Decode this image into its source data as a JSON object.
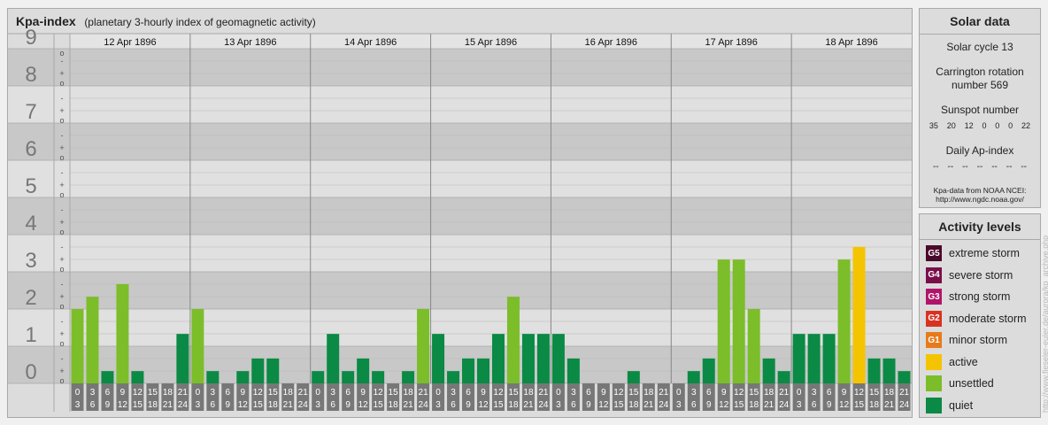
{
  "header": {
    "title": "Kpa-index",
    "subtitle": "(planetary 3-hourly index of geomagnetic activity)"
  },
  "chart_data": {
    "type": "bar",
    "title": "Kpa-index",
    "subtitle": "(planetary 3-hourly index of geomagnetic activity)",
    "ylim": [
      0,
      9
    ],
    "y_major_ticks": [
      "0",
      "1",
      "2",
      "3",
      "4",
      "5",
      "6",
      "7",
      "8",
      "9"
    ],
    "y_minor_ticks": [
      "o",
      "+",
      "-"
    ],
    "days": [
      "12 Apr 1896",
      "13 Apr 1896",
      "14 Apr 1896",
      "15 Apr 1896",
      "16 Apr 1896",
      "17 Apr 1896",
      "18 Apr 1896"
    ],
    "interval_labels": [
      [
        "0",
        "3"
      ],
      [
        "3",
        "6"
      ],
      [
        "6",
        "9"
      ],
      [
        "9",
        "12"
      ],
      [
        "12",
        "15"
      ],
      [
        "15",
        "18"
      ],
      [
        "18",
        "21"
      ],
      [
        "21",
        "24"
      ]
    ],
    "values": [
      2.0,
      2.33,
      0.33,
      2.67,
      0.33,
      0.0,
      0.0,
      1.33,
      2.0,
      0.33,
      0.0,
      0.33,
      0.67,
      0.67,
      0.0,
      0.0,
      0.33,
      1.33,
      0.33,
      0.67,
      0.33,
      0.0,
      0.33,
      2.0,
      1.33,
      0.33,
      0.67,
      0.67,
      1.33,
      2.33,
      1.33,
      1.33,
      1.33,
      0.67,
      0.0,
      0.0,
      0.0,
      0.33,
      0.0,
      0.0,
      0.0,
      0.33,
      0.67,
      3.33,
      3.33,
      2.0,
      0.67,
      0.33,
      1.33,
      1.33,
      1.33,
      3.33,
      3.67,
      0.67,
      0.67,
      0.33
    ],
    "colors": {
      "quiet": "#0a8a44",
      "unsettled": "#7cbd2a",
      "active": "#f5c400"
    },
    "grid": true
  },
  "solar": {
    "title": "Solar data",
    "cycle": "Solar cycle 13",
    "carrington": "Carrington rotation number 569",
    "sunspot_label": "Sunspot number",
    "sunspot_values": [
      "35",
      "20",
      "12",
      "0",
      "0",
      "0",
      "22"
    ],
    "ap_label": "Daily Ap-index",
    "ap_values": [
      "--",
      "--",
      "--",
      "--",
      "--",
      "--",
      "--"
    ],
    "note_1": "Kpa-data from NOAA NCEI:",
    "note_2": "http://www.ngdc.noaa.gov/"
  },
  "levels": {
    "title": "Activity levels",
    "items": [
      {
        "code": "G5",
        "label": "extreme storm",
        "color": "#4a0a2a"
      },
      {
        "code": "G4",
        "label": "severe storm",
        "color": "#7a0e4a"
      },
      {
        "code": "G3",
        "label": "strong storm",
        "color": "#b0156a"
      },
      {
        "code": "G2",
        "label": "moderate storm",
        "color": "#d83222"
      },
      {
        "code": "G1",
        "label": "minor storm",
        "color": "#e87a1a"
      },
      {
        "code": "",
        "label": "active",
        "color": "#f5c400"
      },
      {
        "code": "",
        "label": "unsettled",
        "color": "#7cbd2a"
      },
      {
        "code": "",
        "label": "quiet",
        "color": "#0a8a44"
      }
    ]
  },
  "credit": "http://www.fieseler-euler.de/aurora/kp_archive.php"
}
